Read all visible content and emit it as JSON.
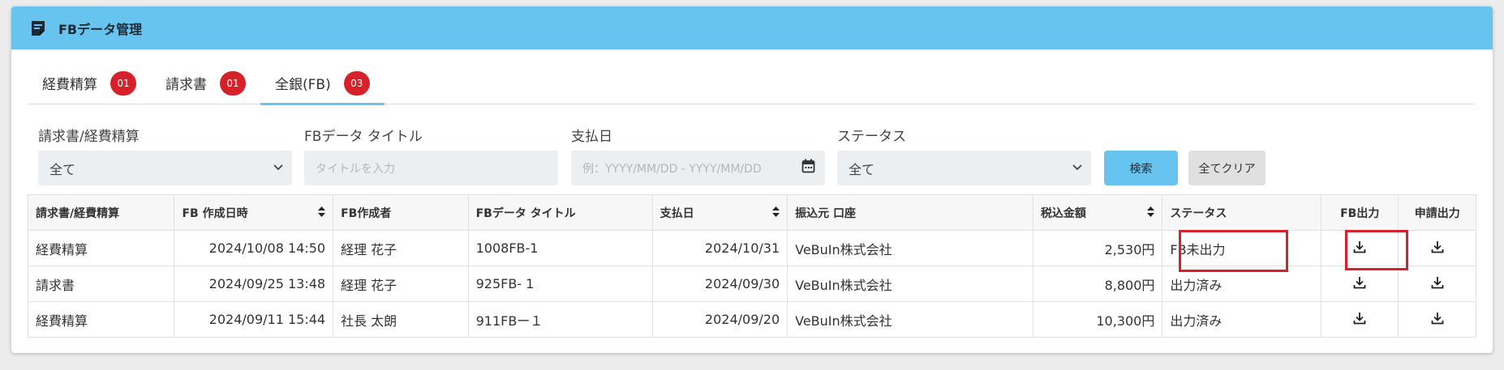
{
  "header": {
    "title": "FBデータ管理",
    "icon": "document-icon",
    "accent": "#66c4ee"
  },
  "tabs": [
    {
      "label": "経費精算",
      "badge": "01"
    },
    {
      "label": "請求書",
      "badge": "01"
    },
    {
      "label": "全銀(FB)",
      "badge": "03",
      "active": true
    }
  ],
  "filters": {
    "type_label": "請求書/経費精算",
    "type_value": "全て",
    "title_label": "FBデータ タイトル",
    "title_placeholder": "タイトルを入力",
    "date_label": "支払日",
    "date_placeholder": "例：YYYY/MM/DD - YYYY/MM/DD",
    "status_label": "ステータス",
    "status_value": "全て",
    "search_label": "検索",
    "clear_label": "全てクリア"
  },
  "table": {
    "headers": [
      "請求書/経費精算",
      "FB 作成日時",
      "FB作成者",
      "FBデータ タイトル",
      "支払日",
      "振込元 口座",
      "税込金額",
      "ステータス",
      "FB出力",
      "申請出力"
    ],
    "rows": [
      {
        "type": "経費精算",
        "created": "2024/10/08 14:50",
        "creator": "経理 花子",
        "title": "1008FB-1",
        "paydate": "2024/10/31",
        "account": "VeBuIn株式会社",
        "amount": "2,530円",
        "status": "FB未出力"
      },
      {
        "type": "請求書",
        "created": "2024/09/25 13:48",
        "creator": "経理 花子",
        "title": "925FB- 1",
        "paydate": "2024/09/30",
        "account": "VeBuIn株式会社",
        "amount": "8,800円",
        "status": "出力済み"
      },
      {
        "type": "経費精算",
        "created": "2024/09/11 15:44",
        "creator": "社長 太朗",
        "title": "911FBー１",
        "paydate": "2024/09/20",
        "account": "VeBuIn株式会社",
        "amount": "10,300円",
        "status": "出力済み"
      }
    ]
  },
  "colors": {
    "badge": "#d6212b",
    "highlight": "#d6212b"
  }
}
